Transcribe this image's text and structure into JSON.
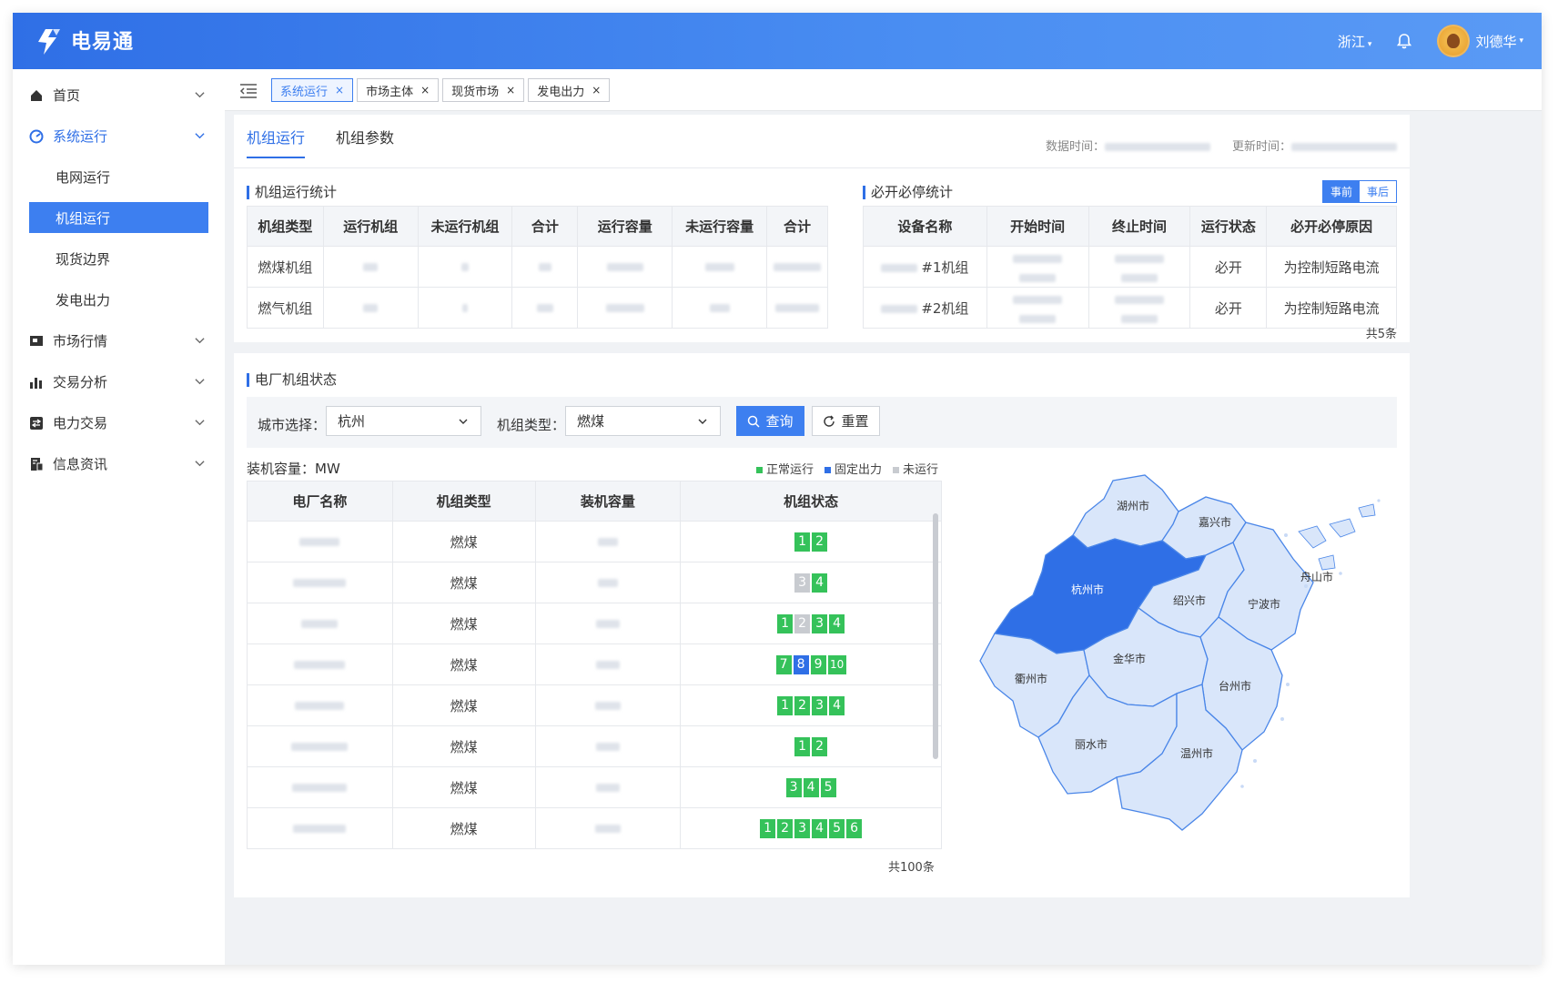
{
  "app": {
    "title": "电易通"
  },
  "header": {
    "region": "浙江",
    "user_name": "刘德华"
  },
  "sidebar": {
    "items": [
      {
        "label": "首页"
      },
      {
        "label": "系统运行",
        "children": [
          "电网运行",
          "机组运行",
          "现货边界",
          "发电出力"
        ],
        "selected": "机组运行"
      },
      {
        "label": "市场行情"
      },
      {
        "label": "交易分析"
      },
      {
        "label": "电力交易"
      },
      {
        "label": "信息资讯"
      }
    ]
  },
  "open_tabs": [
    {
      "label": "系统运行",
      "active": true
    },
    {
      "label": "市场主体"
    },
    {
      "label": "现货市场"
    },
    {
      "label": "发电出力"
    }
  ],
  "page_tabs": {
    "active": "机组运行",
    "other": "机组参数"
  },
  "meta": {
    "data_time_label": "数据时间：",
    "update_time_label": "更新时间："
  },
  "unit_stats": {
    "title": "机组运行统计",
    "columns": [
      "机组类型",
      "运行机组",
      "未运行机组",
      "合计",
      "运行容量",
      "未运行容量",
      "合计"
    ],
    "rows": [
      [
        "燃煤机组",
        "",
        "",
        "",
        "",
        "",
        ""
      ],
      [
        "燃气机组",
        "",
        "",
        "",
        "",
        "",
        ""
      ]
    ]
  },
  "must_run": {
    "title": "必开必停统计",
    "toggle": {
      "before": "事前",
      "after": "事后",
      "active": "before"
    },
    "columns": [
      "设备名称",
      "开始时间",
      "终止时间",
      "运行状态",
      "必开必停原因"
    ],
    "rows": [
      {
        "device": "#1机组",
        "status": "必开",
        "reason": "为控制短路电流"
      },
      {
        "device": "#2机组",
        "status": "必开",
        "reason": "为控制短路电流"
      }
    ],
    "total": "共5条"
  },
  "plant_status": {
    "title": "电厂机组状态",
    "filters": {
      "city_label": "城市选择：",
      "city_value": "杭州",
      "type_label": "机组类型：",
      "type_value": "燃煤",
      "query": "查询",
      "reset": "重置"
    },
    "unit_label": "装机容量：MW",
    "legend": [
      {
        "label": "正常运行",
        "color": "#35c25a"
      },
      {
        "label": "固定出力",
        "color": "#2f6fe6"
      },
      {
        "label": "未运行",
        "color": "#c8cbd0"
      }
    ],
    "columns": [
      "电厂名称",
      "机组类型",
      "装机容量",
      "机组状态"
    ],
    "rows": [
      {
        "type": "燃煤",
        "units": [
          [
            "1",
            "g"
          ],
          [
            "2",
            "g"
          ]
        ]
      },
      {
        "type": "燃煤",
        "units": [
          [
            "3",
            "gr"
          ],
          [
            "4",
            "g"
          ]
        ]
      },
      {
        "type": "燃煤",
        "units": [
          [
            "1",
            "g"
          ],
          [
            "2",
            "gr"
          ],
          [
            "3",
            "g"
          ],
          [
            "4",
            "g"
          ]
        ]
      },
      {
        "type": "燃煤",
        "units": [
          [
            "7",
            "g"
          ],
          [
            "8",
            "b"
          ],
          [
            "9",
            "g"
          ],
          [
            "10",
            "g"
          ]
        ]
      },
      {
        "type": "燃煤",
        "units": [
          [
            "1",
            "g"
          ],
          [
            "2",
            "g"
          ],
          [
            "3",
            "g"
          ],
          [
            "4",
            "g"
          ]
        ]
      },
      {
        "type": "燃煤",
        "units": [
          [
            "1",
            "g"
          ],
          [
            "2",
            "g"
          ]
        ]
      },
      {
        "type": "燃煤",
        "units": [
          [
            "3",
            "g"
          ],
          [
            "4",
            "g"
          ],
          [
            "5",
            "g"
          ]
        ]
      },
      {
        "type": "燃煤",
        "units": [
          [
            "1",
            "g"
          ],
          [
            "2",
            "g"
          ],
          [
            "3",
            "g"
          ],
          [
            "4",
            "g"
          ],
          [
            "5",
            "g"
          ],
          [
            "6",
            "g"
          ]
        ]
      }
    ],
    "total": "共100条"
  },
  "map": {
    "highlighted": "杭州市",
    "cities": [
      "湖州市",
      "嘉兴市",
      "杭州市",
      "绍兴市",
      "宁波市",
      "舟山市",
      "衢州市",
      "金华市",
      "台州市",
      "丽水市",
      "温州市"
    ],
    "colors": {
      "highlight": "#2f6fe6",
      "base": "#d9e6fa",
      "border": "#4a86e8"
    }
  }
}
